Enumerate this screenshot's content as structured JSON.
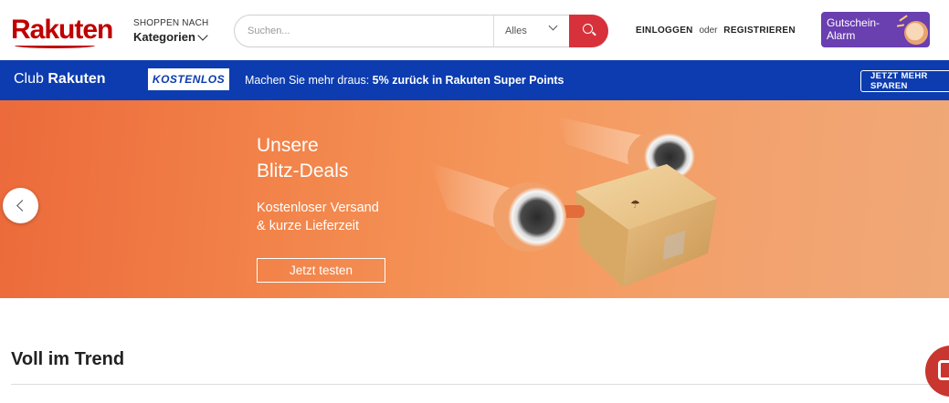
{
  "header": {
    "logo_text": "Rakuten",
    "categories_small": "SHOPPEN NACH",
    "categories_label": "Kategorien",
    "search_placeholder": "Suchen...",
    "search_scope": "Alles",
    "login": "EINLOGGEN",
    "or": "oder",
    "register": "REGISTRIEREN",
    "coupon_label": "Gutschein-Alarm"
  },
  "club": {
    "logo_left": "Club",
    "logo_right": "Rakuten",
    "badge": "KOSTENLOS",
    "message_prefix": "Machen Sie mehr draus:",
    "message_bold": "5% zurück in Rakuten Super Points",
    "button": "JETZT MEHR SPAREN"
  },
  "hero": {
    "title_line1": "Unsere",
    "title_line2": "Blitz-Deals",
    "sub_line1": "Kostenloser Versand",
    "sub_line2": "& kurze Lieferzeit",
    "cta": "Jetzt testen"
  },
  "section": {
    "title": "Voll im Trend"
  },
  "colors": {
    "brand_red": "#bf0000",
    "club_blue": "#0c3caf",
    "search_button": "#d7323c",
    "coupon_purple": "#6a3fb0",
    "hero_orange": "#f2844a"
  },
  "icons": {
    "search": "search-icon",
    "chevron": "chevron-down-icon",
    "prev": "chevron-left-icon",
    "chat": "chat-icon"
  }
}
